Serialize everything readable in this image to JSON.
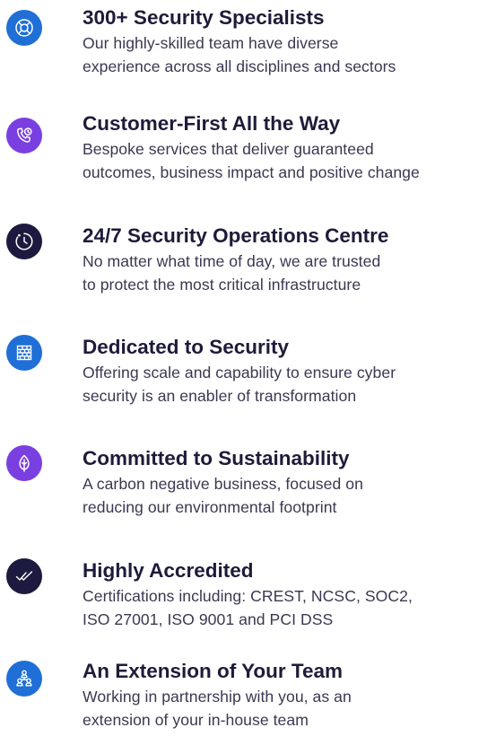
{
  "colors": {
    "blue": "#1f6fd6",
    "purple": "#7a3fe0",
    "navy": "#1c1a3e",
    "title": "#1e1b3a",
    "body": "#3a3852"
  },
  "features": [
    {
      "icon": "lifebuoy-icon",
      "title": "300+ Security Specialists",
      "description_lines": [
        "Our highly-skilled team have diverse",
        "experience across all disciplines and sectors"
      ]
    },
    {
      "icon": "phone-clock-icon",
      "title": "Customer-First All the Way",
      "description_lines": [
        "Bespoke services that deliver guaranteed",
        "outcomes, business impact and positive change"
      ]
    },
    {
      "icon": "clock-icon",
      "title": "24/7 Security Operations Centre",
      "description_lines": [
        "No matter what time of day, we are trusted",
        "to protect the most critical infrastructure"
      ]
    },
    {
      "icon": "firewall-icon",
      "title": "Dedicated to Security",
      "description_lines": [
        "Offering scale and capability to ensure cyber",
        "security is an enabler of transformation"
      ]
    },
    {
      "icon": "leaf-icon",
      "title": "Committed to Sustainability",
      "description_lines": [
        "A carbon negative business, focused on",
        "reducing our environmental footprint"
      ]
    },
    {
      "icon": "double-check-icon",
      "title": "Highly Accredited",
      "description_lines": [
        "Certifications including: CREST, NCSC, SOC2,",
        "ISO 27001, ISO 9001 and PCI DSS"
      ]
    },
    {
      "icon": "team-icon",
      "title": "An Extension of Your Team",
      "description_lines": [
        "Working in partnership with you, as an",
        "extension of your in-house team"
      ]
    }
  ]
}
